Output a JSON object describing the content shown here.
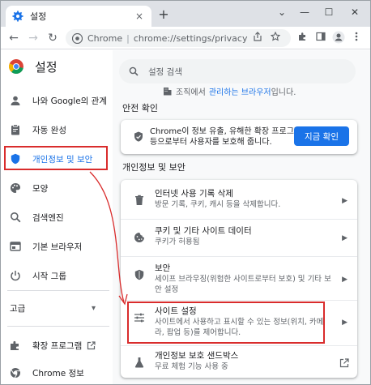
{
  "tab": {
    "title": "설정",
    "close": "×",
    "new_tab": "+"
  },
  "window_controls": {
    "chevron": "⌄",
    "minimize": "—",
    "maximize": "☐",
    "close": "✕"
  },
  "toolbar": {
    "back": "←",
    "forward": "→",
    "reload": "↻",
    "chrome_label": "Chrome",
    "separator": "|",
    "url": "chrome://settings/privacy"
  },
  "settings": {
    "title": "설정"
  },
  "sidebar": {
    "items": [
      {
        "label": "나와 Google의 관계",
        "icon": "person-icon"
      },
      {
        "label": "자동 완성",
        "icon": "clipboard-icon"
      },
      {
        "label": "개인정보 및 보안",
        "icon": "shield-icon",
        "active": true
      },
      {
        "label": "모양",
        "icon": "palette-icon"
      },
      {
        "label": "검색엔진",
        "icon": "search-icon"
      },
      {
        "label": "기본 브라우저",
        "icon": "browser-icon"
      },
      {
        "label": "시작 그룹",
        "icon": "power-icon"
      }
    ],
    "advanced": {
      "label": "고급",
      "chevron": "▾"
    },
    "extensions": {
      "label": "확장 프로그램"
    },
    "about": {
      "label": "Chrome 정보"
    }
  },
  "search": {
    "placeholder": "설정 검색"
  },
  "managed": {
    "text": "조직에서",
    "link": "관리하는 브라우저",
    "suffix": "입니다."
  },
  "safety_check": {
    "section_title": "안전 확인",
    "text": "Chrome이 정보 유출, 유해한 확장 프로그램 등으로부터 사용자를 보호해 줍니다.",
    "button": "지금 확인"
  },
  "privacy": {
    "section_title": "개인정보 및 보안",
    "rows": [
      {
        "title": "인터넷 사용 기록 삭제",
        "sub": "방문 기록, 쿠키, 캐시 등을 삭제합니다.",
        "icon": "trash-icon",
        "chevron": "▶"
      },
      {
        "title": "쿠키 및 기타 사이트 데이터",
        "sub": "쿠키가 허용됨",
        "icon": "cookie-icon",
        "chevron": "▶"
      },
      {
        "title": "보안",
        "sub": "세이프 브라우징(위험한 사이트로부터 보호) 및 기타 보안 설정",
        "icon": "shield-icon",
        "chevron": "▶"
      },
      {
        "title": "사이트 설정",
        "sub": "사이트에서 사용하고 표시할 수 있는 정보(위치, 카메라, 팝업 등)를 제어합니다.",
        "icon": "sliders-icon",
        "chevron": "▶"
      },
      {
        "title": "개인정보 보호 샌드박스",
        "sub": "무료 체험 기능 사용 중",
        "icon": "flask-icon",
        "chevron": ""
      }
    ]
  },
  "colors": {
    "accent": "#1a73e8",
    "highlight": "#d92c2c"
  }
}
